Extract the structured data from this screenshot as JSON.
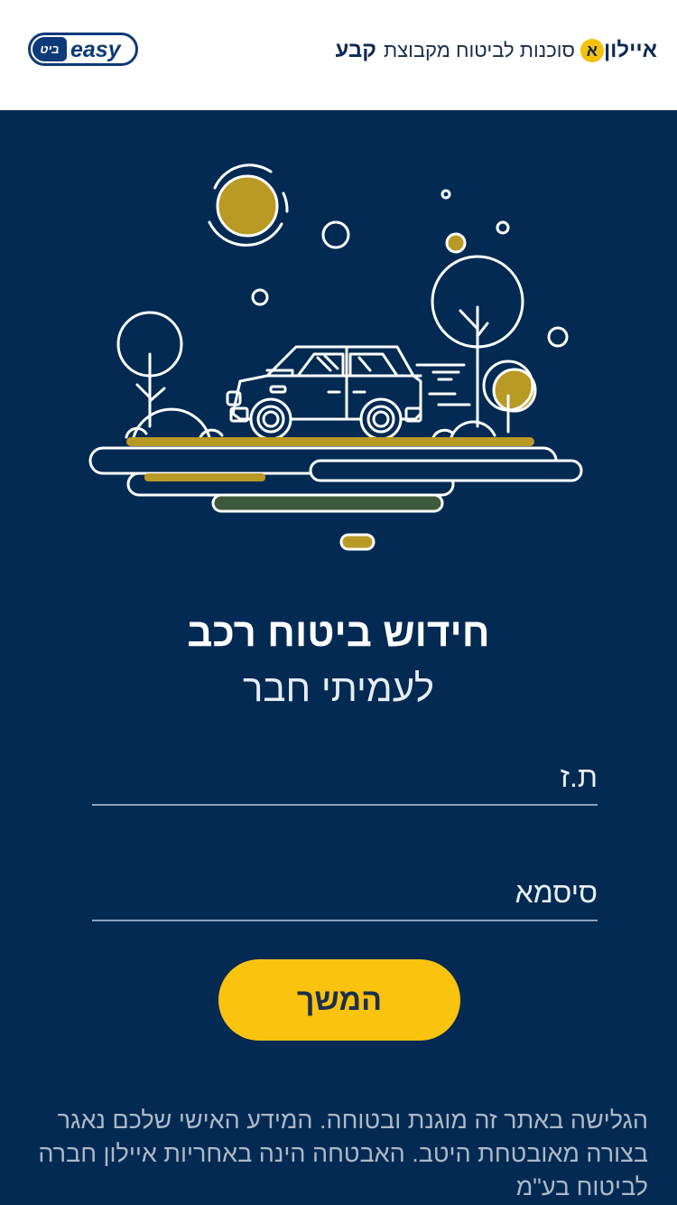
{
  "header": {
    "easy_logo_text": "easy",
    "easy_logo_badge": "ביט",
    "brand_kevah": "קבע",
    "brand_agency": "סוכנות לביטוח מקבוצת",
    "brand_ayalon": "איילון"
  },
  "main": {
    "title": "חידוש ביטוח רכב",
    "subtitle": "לעמיתי חבר"
  },
  "form": {
    "id_placeholder": "ת.ז",
    "id_value": "",
    "password_placeholder": "סיסמא",
    "password_value": "",
    "continue_label": "המשך"
  },
  "footer": {
    "disclaimer": "הגלישה באתר זה מוגנת ובטוחה. המידע האישי שלכם נאגר בצורה מאובטחת היטב. האבטחה הינה באחריות איילון חברה לביטוח בע\"מ"
  },
  "colors": {
    "background": "#032a52",
    "accent_yellow": "#f9c30f",
    "gold": "#b89a25",
    "dark_green": "#3d5a3a"
  }
}
